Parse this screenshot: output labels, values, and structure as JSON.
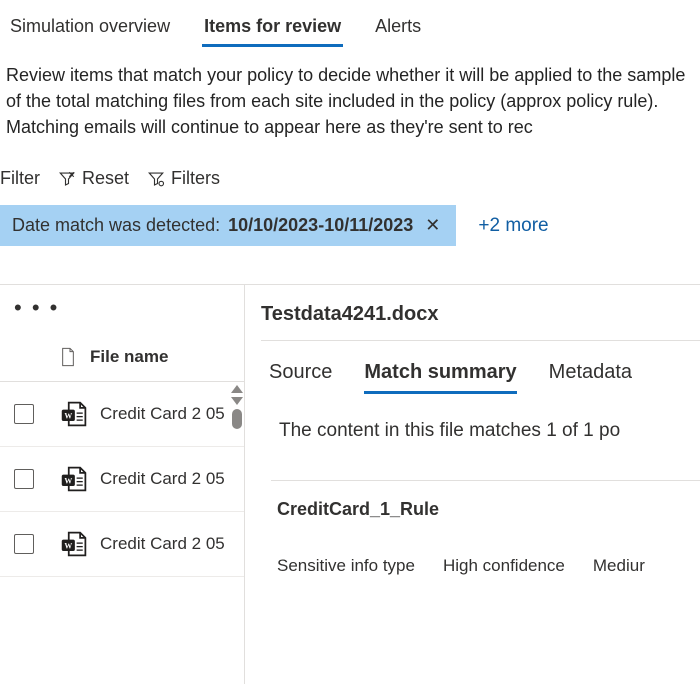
{
  "tabs": {
    "overview": "Simulation overview",
    "items": "Items for review",
    "alerts": "Alerts"
  },
  "description": "Review items that match your policy to decide whether it will be applied to the sample of the total matching files from each site included in the policy (approx policy rule). Matching emails will continue to appear here as they're sent to rec",
  "toolbar": {
    "filter": "Filter",
    "reset": "Reset",
    "filters": "Filters"
  },
  "filter_pill": {
    "label": "Date match was detected:",
    "value": "10/10/2023-10/11/2023"
  },
  "more_filters": "+2 more",
  "col_header": "File name",
  "rows": [
    {
      "name": "Credit Card 2 05"
    },
    {
      "name": "Credit Card 2 05"
    },
    {
      "name": "Credit Card 2 05"
    }
  ],
  "detail": {
    "doc_title": "Testdata4241.docx",
    "tabs": {
      "source": "Source",
      "match": "Match summary",
      "meta": "Metadata"
    },
    "summary_text": "The content in this file matches 1 of 1 po",
    "rule_name": "CreditCard_1_Rule",
    "sit_cols": {
      "type": "Sensitive info type",
      "high": "High confidence",
      "med": "Mediur"
    }
  }
}
